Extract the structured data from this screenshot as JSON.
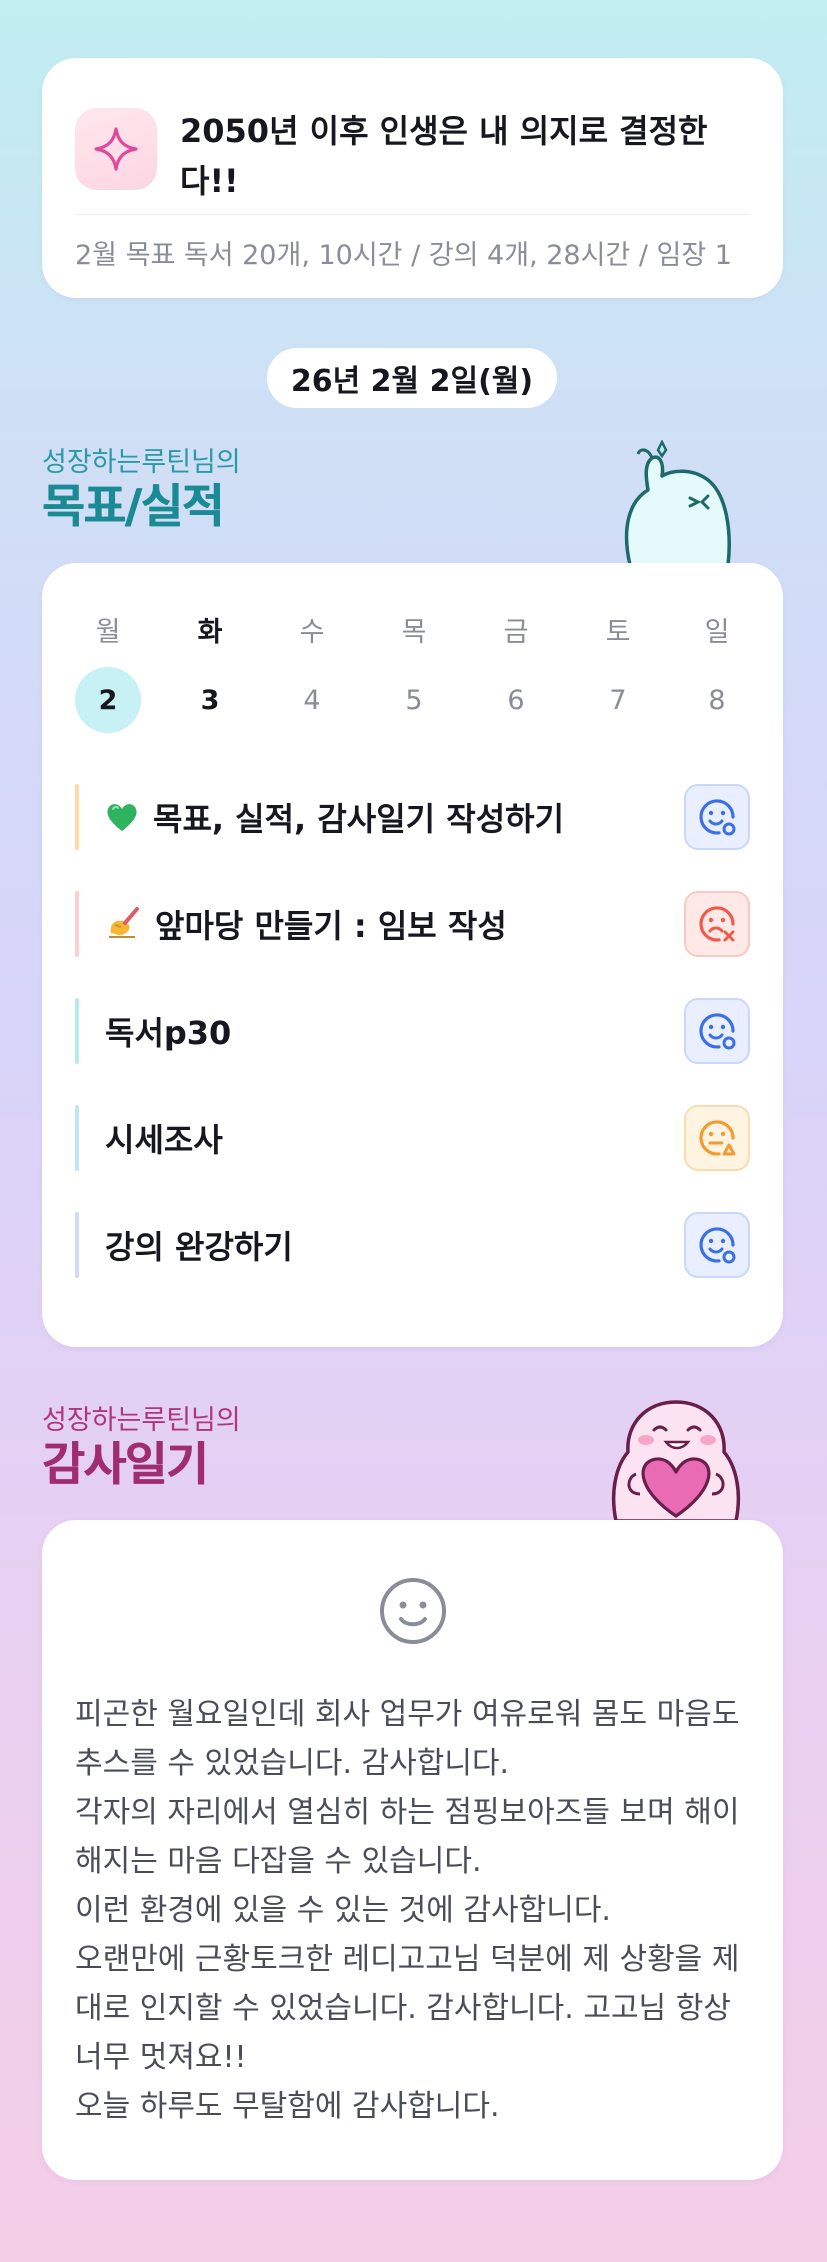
{
  "goal": {
    "title": "2050년 이후 인생은 내 의지로 결정한다!!",
    "subtitle": "2월 목표  독서 20개, 10시간 / 강의 4개, 28시간 / 임장 1"
  },
  "date_label": "26년 2월 2일(월)",
  "goals_section": {
    "owner": "성장하는루틴님의",
    "title": "목표/실적"
  },
  "week": {
    "days": [
      {
        "name": "월",
        "num": "2",
        "selected": true
      },
      {
        "name": "화",
        "num": "3",
        "bold": true
      },
      {
        "name": "수",
        "num": "4"
      },
      {
        "name": "목",
        "num": "5"
      },
      {
        "name": "금",
        "num": "6"
      },
      {
        "name": "토",
        "num": "7"
      },
      {
        "name": "일",
        "num": "8"
      }
    ]
  },
  "tasks": [
    {
      "emoji": "green-heart-icon",
      "label": "목표, 실적, 감사일기 작성하기",
      "bar_color": "#ffd9a8",
      "status": "good"
    },
    {
      "emoji": "writing-hand-icon",
      "label": "앞마당 만들기 : 임보 작성",
      "bar_color": "#ffcfcf",
      "status": "bad"
    },
    {
      "emoji": "",
      "label": "독서p30",
      "bar_color": "#b8ecea",
      "status": "good"
    },
    {
      "emoji": "",
      "label": "시세조사",
      "bar_color": "#bfe6f7",
      "status": "meh"
    },
    {
      "emoji": "",
      "label": "강의 완강하기",
      "bar_color": "#cfdaf7",
      "status": "good"
    }
  ],
  "status_colors": {
    "good": "#3b6fe8",
    "bad": "#f05a4a",
    "meh": "#f59a2f"
  },
  "diary_section": {
    "owner": "성장하는루틴님의",
    "title": "감사일기"
  },
  "diary": {
    "face_icon": "smile-face-icon",
    "text": "피곤한 월요일인데 회사 업무가 여유로워 몸도 마음도 추스를 수 있었습니다. 감사합니다.\n각자의 자리에서 열심히 하는 점핑보아즈들 보며 해이해지는 마음 다잡을 수 있습니다.\n이런 환경에 있을 수 있는 것에 감사합니다.\n오랜만에 근황토크한 레디고고님 덕분에 제 상황을 제대로 인지할 수 있었습니다. 감사합니다. 고고님 항상 너무 멋져요!!\n오늘 하루도 무탈함에 감사합니다."
  }
}
